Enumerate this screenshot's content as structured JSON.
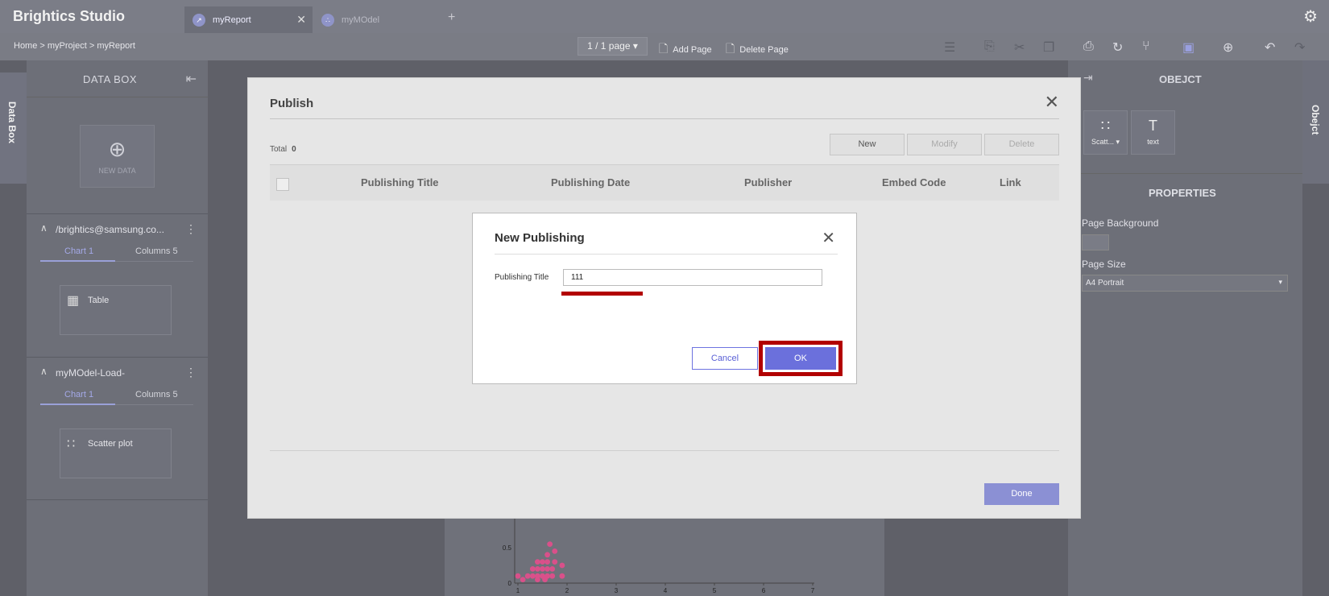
{
  "app": {
    "brand": "Brightics Studio",
    "tabs": [
      {
        "label": "myReport",
        "active": true
      },
      {
        "label": "myMOdel",
        "active": false
      }
    ]
  },
  "toolbar": {
    "breadcrumb": "Home > myProject > myReport",
    "page_select": "1 / 1 page",
    "add_page": "Add Page",
    "delete_page": "Delete Page"
  },
  "side_tabs": {
    "left": "Data Box",
    "right": "Obejct"
  },
  "data_box": {
    "title": "DATA BOX",
    "new_data": "NEW DATA",
    "sources": [
      {
        "name": "/brightics@samsung.co...",
        "tab1": "Chart 1",
        "tab2": "Columns 5",
        "card": "Table"
      },
      {
        "name": "myMOdel-Load-",
        "tab1": "Chart 1",
        "tab2": "Columns 5",
        "card": "Scatter plot"
      }
    ]
  },
  "object_panel": {
    "title": "OBEJCT",
    "items": [
      {
        "label": "Scatt...",
        "icon": "scatter-icon"
      },
      {
        "label": "text",
        "icon": "text-icon"
      }
    ],
    "properties_title": "PROPERTIES",
    "page_background_label": "Page Background",
    "page_size_label": "Page Size",
    "page_size_value": "A4 Portrait"
  },
  "publish_dialog": {
    "title": "Publish",
    "total_label": "Total",
    "total_value": "0",
    "buttons": {
      "new": "New",
      "modify": "Modify",
      "delete": "Delete"
    },
    "columns": [
      "Publishing Title",
      "Publishing Date",
      "Publisher",
      "Embed Code",
      "Link"
    ],
    "done": "Done"
  },
  "new_publishing_dialog": {
    "title": "New Publishing",
    "field_label": "Publishing Title",
    "field_value": "111",
    "cancel": "Cancel",
    "ok": "OK"
  },
  "colors": {
    "accent": "#6b70dc",
    "highlight": "#b20000",
    "scatter_point": "#d9508a"
  },
  "chart_data": {
    "type": "scatter",
    "x_ticks": [
      "1",
      "2",
      "3",
      "4",
      "5",
      "6",
      "7"
    ],
    "y_ticks": [
      "0",
      "0.5"
    ],
    "points": [
      [
        1.0,
        0.1
      ],
      [
        1.1,
        0.05
      ],
      [
        1.2,
        0.1
      ],
      [
        1.3,
        0.1
      ],
      [
        1.3,
        0.2
      ],
      [
        1.4,
        0.05
      ],
      [
        1.4,
        0.1
      ],
      [
        1.4,
        0.2
      ],
      [
        1.4,
        0.3
      ],
      [
        1.5,
        0.1
      ],
      [
        1.5,
        0.2
      ],
      [
        1.5,
        0.3
      ],
      [
        1.55,
        0.05
      ],
      [
        1.6,
        0.1
      ],
      [
        1.6,
        0.2
      ],
      [
        1.6,
        0.3
      ],
      [
        1.6,
        0.4
      ],
      [
        1.65,
        0.55
      ],
      [
        1.7,
        0.1
      ],
      [
        1.7,
        0.2
      ],
      [
        1.75,
        0.3
      ],
      [
        1.75,
        0.45
      ],
      [
        1.9,
        0.1
      ],
      [
        1.9,
        0.25
      ]
    ]
  }
}
